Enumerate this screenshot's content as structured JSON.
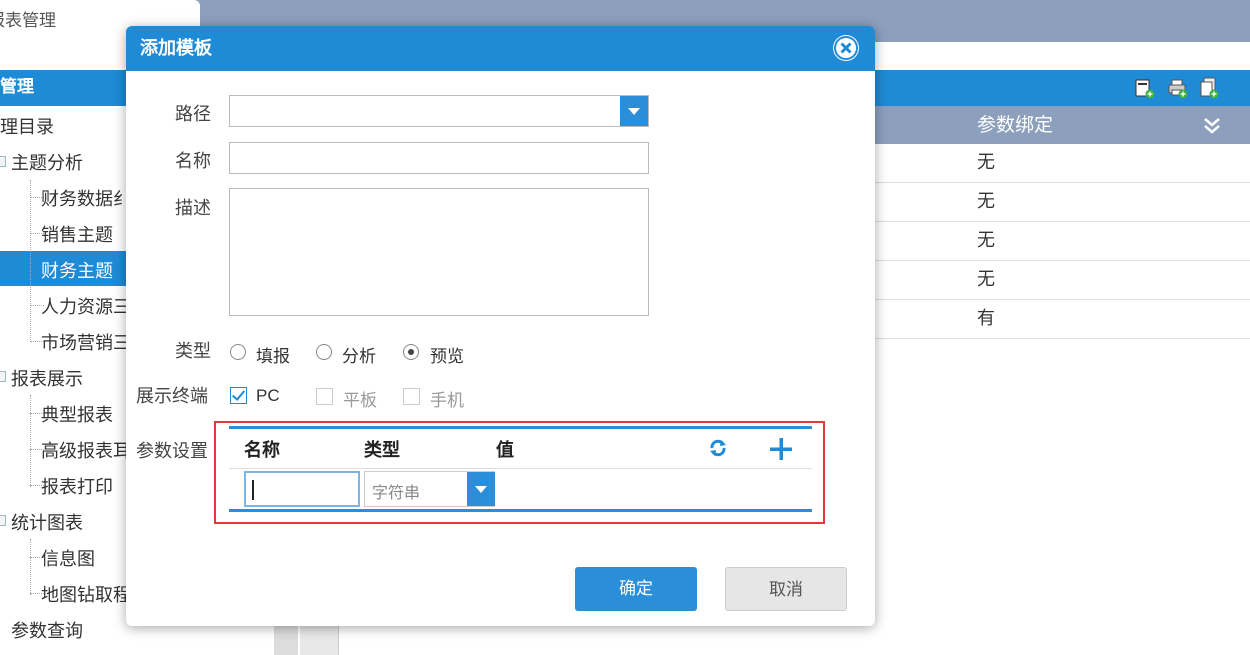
{
  "tab": {
    "label": "报表管理"
  },
  "left_panel": {
    "header": "管理",
    "items": [
      {
        "label": "理目录"
      },
      {
        "label": "主题分析"
      },
      {
        "label": "财务数据纟"
      },
      {
        "label": "销售主题"
      },
      {
        "label": "财务主题"
      },
      {
        "label": "人力资源三"
      },
      {
        "label": "市场营销三"
      },
      {
        "label": "报表展示"
      },
      {
        "label": "典型报表"
      },
      {
        "label": "高级报表耳"
      },
      {
        "label": "报表打印"
      },
      {
        "label": "统计图表"
      },
      {
        "label": "信息图"
      },
      {
        "label": "地图钻取程"
      },
      {
        "label": "参数查询"
      }
    ]
  },
  "right_panel": {
    "column_header": "参数绑定",
    "rows": [
      "无",
      "无",
      "无",
      "无",
      "有"
    ],
    "header_icons": [
      "add-report-icon",
      "print-add-icon",
      "copy-add-icon"
    ]
  },
  "dialog": {
    "title": "添加模板",
    "path_label": "路径",
    "path_value": "",
    "name_label": "名称",
    "name_value": "",
    "desc_label": "描述",
    "desc_value": "",
    "type_label": "类型",
    "type_options": [
      "填报",
      "分析",
      "预览"
    ],
    "type_selected": "预览",
    "terminal_label": "展示终端",
    "terminal_options": [
      {
        "label": "PC",
        "checked": true,
        "enabled": true
      },
      {
        "label": "平板",
        "checked": false,
        "enabled": false
      },
      {
        "label": "手机",
        "checked": false,
        "enabled": false
      }
    ],
    "param_label": "参数设置",
    "param_headers": {
      "name": "名称",
      "type": "类型",
      "value": "值"
    },
    "param_row": {
      "name": "",
      "type": "字符串"
    },
    "ok_label": "确定",
    "cancel_label": "取消"
  },
  "colors": {
    "accent": "#1f8ad5",
    "header_gray": "#8c9fbd",
    "highlight_red": "#e23a3a"
  }
}
